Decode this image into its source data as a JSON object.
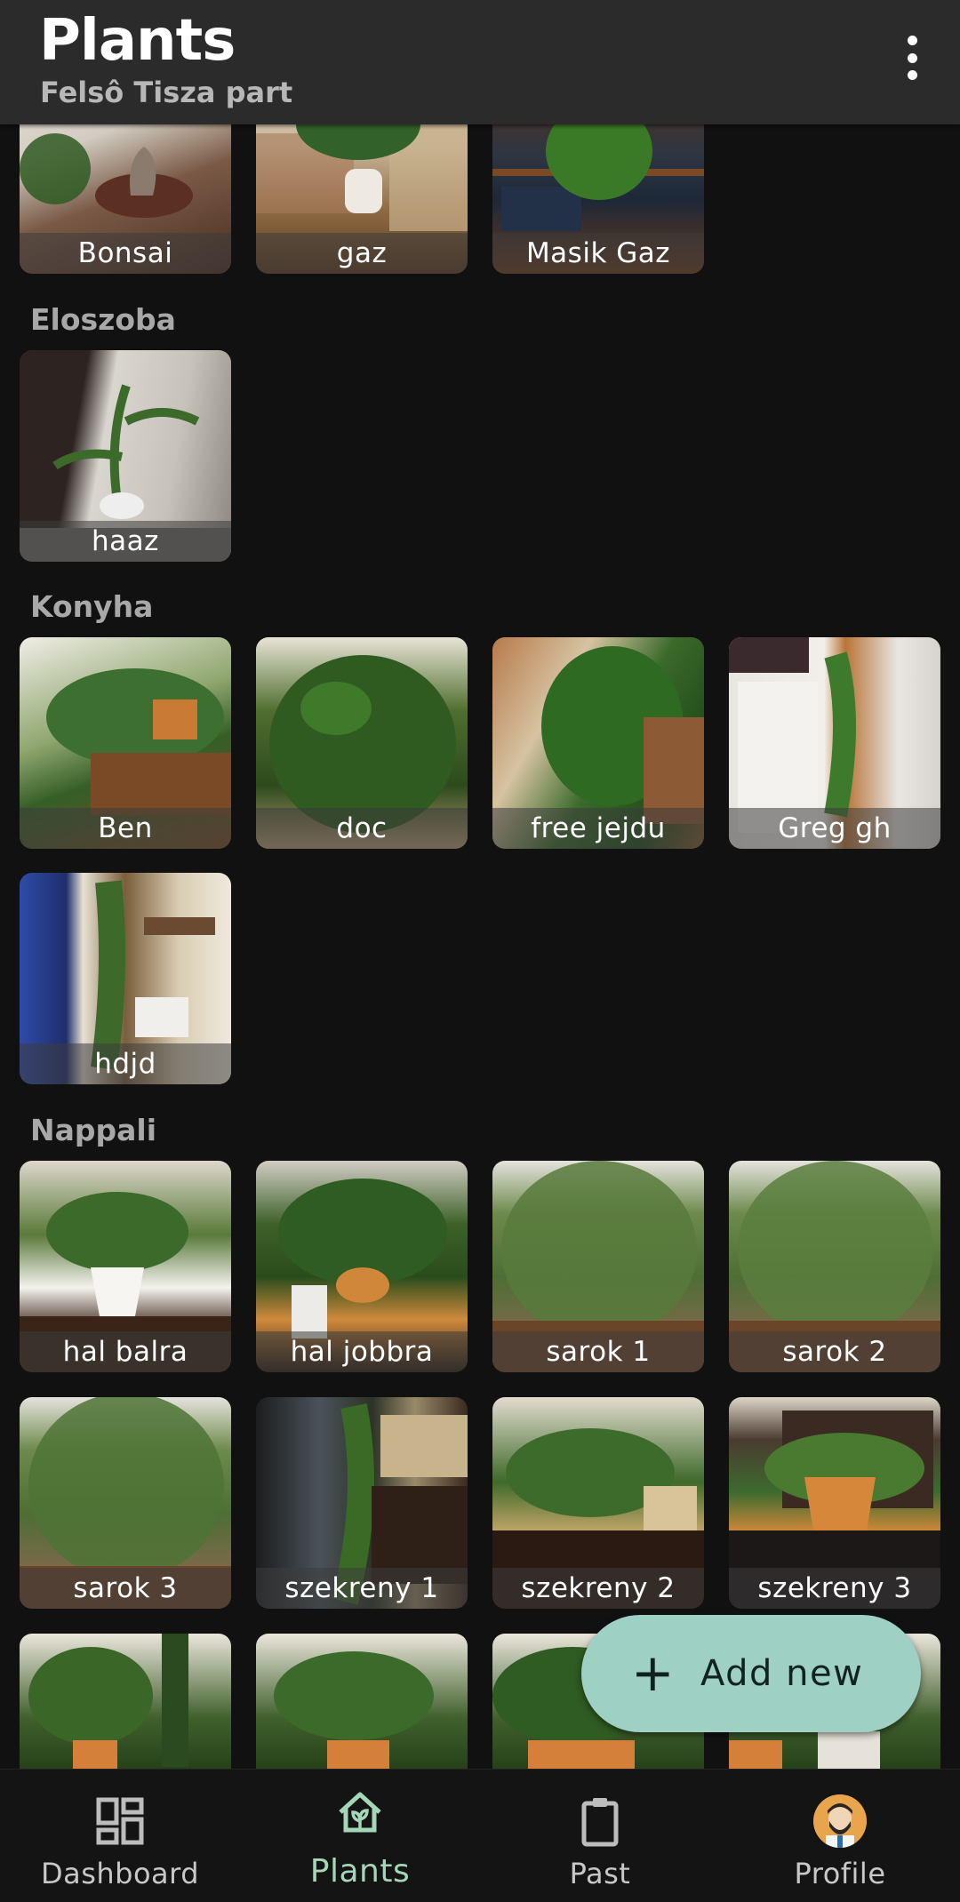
{
  "appbar": {
    "title": "Plants",
    "subtitle": "Felsô Tisza part",
    "menu_icon": "more-vert-icon"
  },
  "sections": [
    {
      "title": "",
      "plants": [
        "Bonsai",
        "gaz",
        "Masik Gaz"
      ]
    },
    {
      "title": "Eloszoba",
      "plants": [
        "haaz"
      ]
    },
    {
      "title": "Konyha",
      "plants": [
        "Ben",
        "doc",
        "free jejdu",
        "Greg gh",
        "hdjd"
      ]
    },
    {
      "title": "Nappali",
      "plants": [
        "hal balra",
        "hal jobbra",
        "sarok 1",
        "sarok 2",
        "sarok 3",
        "szekreny 1",
        "szekreny 2",
        "szekreny 3"
      ]
    }
  ],
  "fab": {
    "label": "Add new",
    "icon": "plus-icon",
    "color": "#9ed0c4"
  },
  "bottom_nav": [
    {
      "label": "Dashboard",
      "icon": "dashboard-icon"
    },
    {
      "label": "Plants",
      "icon": "home-plant-icon",
      "active": true
    },
    {
      "label": "Past",
      "icon": "clipboard-icon"
    },
    {
      "label": "Profile",
      "icon": "avatar-icon"
    }
  ],
  "colors": {
    "background": "#111112",
    "appbar": "#2b2b2c",
    "active_nav": "#a4d7b9"
  }
}
